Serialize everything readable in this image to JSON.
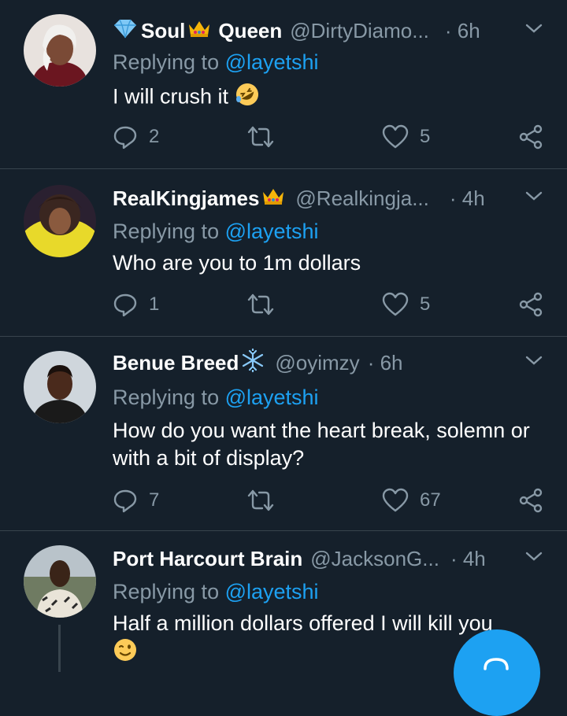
{
  "tweets": [
    {
      "name": "Soul",
      "name2": "Queen",
      "handle": "@DirtyDiamo...",
      "time": "· 6h",
      "replying_prefix": "Replying to ",
      "replying_to": "@layetshi",
      "text": "I will crush it",
      "replies": "2",
      "retweets": "",
      "likes": "5"
    },
    {
      "name": "RealKingjames",
      "handle": "@Realkingja...",
      "time": "· 4h",
      "replying_prefix": "Replying to ",
      "replying_to": "@layetshi",
      "text": "Who are you to 1m dollars",
      "replies": "1",
      "retweets": "",
      "likes": "5"
    },
    {
      "name": "Benue Breed",
      "handle": "@oyimzy",
      "time": "· 6h",
      "replying_prefix": "Replying to ",
      "replying_to": "@layetshi",
      "text": "How do you want the heart break, solemn or with a bit of display?",
      "replies": "7",
      "retweets": "",
      "likes": "67"
    },
    {
      "name": "Port Harcourt Brain",
      "handle": "@JacksonG...",
      "time": "· 4h",
      "replying_prefix": "Replying to ",
      "replying_to": "@layetshi",
      "text": "Half a million dollars offered I will kill you"
    }
  ],
  "icons": {
    "reply": "reply-icon",
    "retweet": "retweet-icon",
    "like": "heart-icon",
    "share": "share-icon",
    "menu": "chevron-down-icon"
  },
  "colors": {
    "background": "#15202b",
    "secondary_text": "#8899a6",
    "accent": "#1da1f2",
    "divider": "#38444d"
  }
}
